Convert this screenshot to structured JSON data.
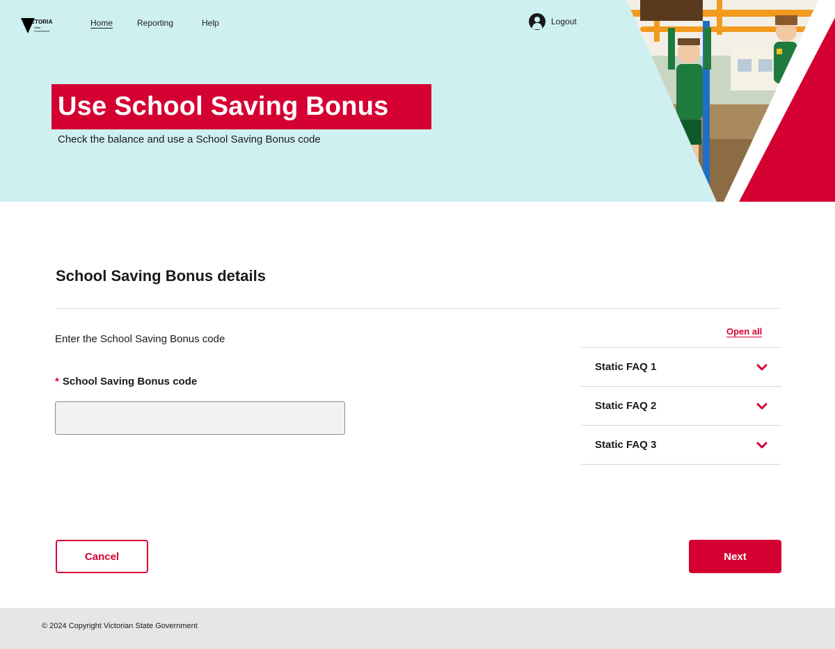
{
  "header": {
    "logo": {
      "word": "VICTORIA",
      "sub": "State Government"
    },
    "nav": [
      {
        "label": "Home",
        "active": true
      },
      {
        "label": "Reporting",
        "active": false
      },
      {
        "label": "Help",
        "active": false
      }
    ],
    "logout_label": "Logout"
  },
  "hero": {
    "title": "Use School Saving Bonus",
    "subtitle": "Check the balance and use a School Saving Bonus code"
  },
  "main": {
    "section_title": "School Saving Bonus details",
    "instruction": "Enter the School Saving Bonus code",
    "field": {
      "required_marker": "*",
      "label": "School Saving Bonus code",
      "value": "",
      "placeholder": ""
    }
  },
  "faq": {
    "open_all_label": "Open all",
    "items": [
      {
        "label": "Static FAQ 1"
      },
      {
        "label": "Static FAQ 2"
      },
      {
        "label": "Static FAQ 3"
      }
    ]
  },
  "actions": {
    "cancel_label": "Cancel",
    "next_label": "Next"
  },
  "footer": {
    "copyright": "© 2024 Copyright Victorian State Government"
  },
  "colors": {
    "brand_red": "#d50032",
    "hero_bg": "#cff0f0",
    "footer_bg": "#e6e6e6"
  }
}
